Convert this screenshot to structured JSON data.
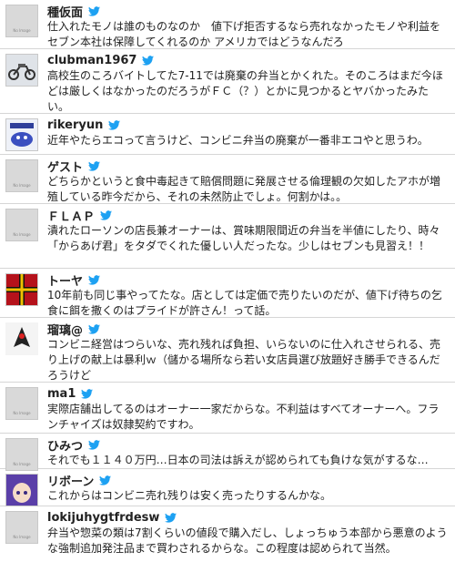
{
  "icons": {
    "twitter_bird": "twitter-bird-icon",
    "twitter_color": "#1da1f2"
  },
  "no_image_label": "No Image",
  "items": [
    {
      "name": "種仮面",
      "avatar": "no-image",
      "text": "仕入れたモノは誰のものなのか　値下げ拒否するなら売れなかったモノや利益をセブン本社は保障してくれるのか アメリカではどうなんだろ"
    },
    {
      "name": "clubman1967",
      "avatar": "motorcycle",
      "text": "高校生のころバイトしてた7-11では廃棄の弁当とかくれた。そのころはまだ今ほどは厳しくはなかったのだろうがＦＣ（？）とかに見つかるとヤバかったみたい。"
    },
    {
      "name": "rikeryun",
      "avatar": "character",
      "text": "近年やたらエコって言うけど、コンビニ弁当の廃棄が一番非エコやと思うわ。"
    },
    {
      "name": "ゲスト",
      "avatar": "no-image",
      "text": "どちらかというと食中毒起きて賠償問題に発展させる倫理観の欠如したアホが増殖している昨今だから、それの未然防止でしょ。何割かは。。"
    },
    {
      "name": "ＦＬＡＰ",
      "avatar": "no-image",
      "text": "潰れたローソンの店長兼オーナーは、賞味期限間近の弁当を半値にしたり、時々「からあげ君」をタダでくれた優しい人だったな。少しはセブンも見習え！！"
    },
    {
      "name": "トーヤ",
      "avatar": "flag",
      "text": "10年前も同じ事やってたな。店としては定価で売りたいのだが、値下げ待ちの乞食に餌を撒くのはプライドが許さん！って話。"
    },
    {
      "name": "瑠璃@",
      "avatar": "figure",
      "text": "コンビニ経営はつらいな、売れ残れば負担、いらないのに仕入れさせられる、売り上げの献上は暴利ｗ（儲かる場所なら若い女店員選び放題好き勝手できるんだろうけど"
    },
    {
      "name": "ma1",
      "avatar": "no-image",
      "text": "実際店舗出してるのはオーナー一家だからな。不利益はすべてオーナーへ。フランチャイズは奴隷契約ですわ。"
    },
    {
      "name": "ひみつ",
      "avatar": "no-image",
      "text": "それでも１１４０万円…日本の司法は訴えが認められても負けな気がするな…"
    },
    {
      "name": "リボーン",
      "avatar": "anime",
      "text": "これからはコンビニ売れ残りは安く売ったりするんかな。"
    },
    {
      "name": "lokijuhygtfrdesw",
      "avatar": "no-image",
      "text": "弁当や惣菜の類は7割くらいの値段で購入だし、しょっちゅう本部から悪意のような強制追加発注品まで買わされるからな。この程度は認められて当然。"
    }
  ]
}
